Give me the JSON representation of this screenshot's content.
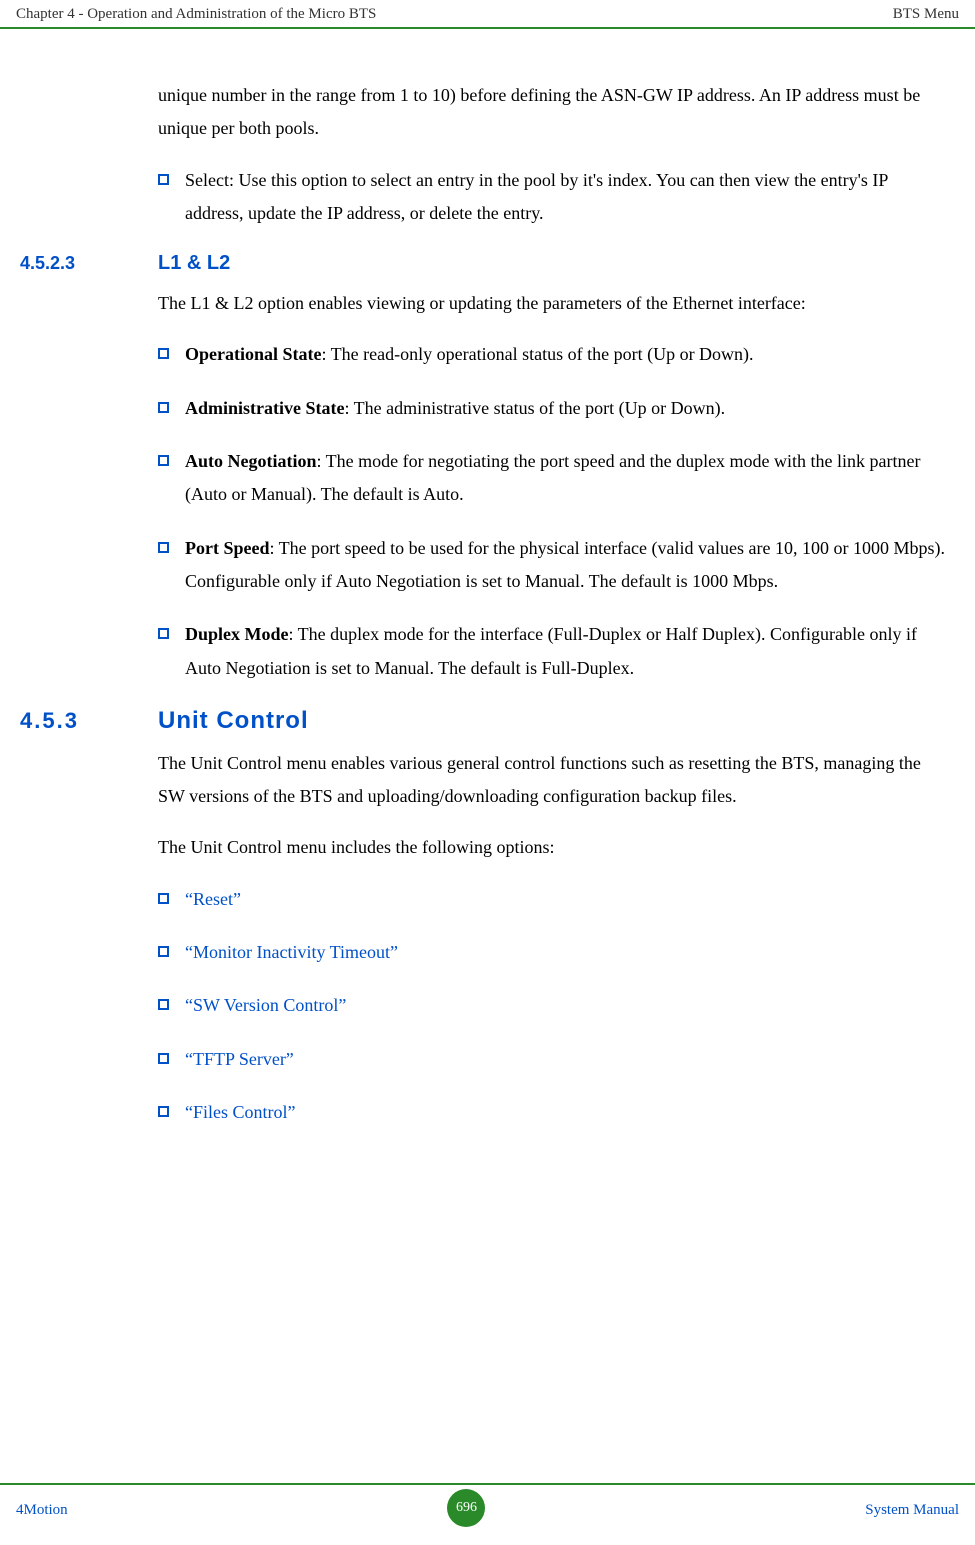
{
  "header": {
    "left": "Chapter 4 - Operation and Administration of the Micro BTS",
    "right": "BTS Menu"
  },
  "intro": {
    "para1": "unique number in the range from 1 to 10) before defining the ASN-GW IP address. An IP address must be unique per both pools.",
    "select_item": "Select: Use this option to select an entry in the pool by it's index. You can then view the entry's IP address, update the IP address, or delete the entry."
  },
  "section_4523": {
    "num": "4.5.2.3",
    "title": "L1 & L2",
    "para": "The L1 & L2 option enables viewing or updating the parameters of the Ethernet interface:",
    "items": [
      {
        "bold": "Operational State",
        "rest": ": The read-only operational status of the port (Up or Down)."
      },
      {
        "bold": "Administrative State",
        "rest": ": The administrative status of the port (Up or Down)."
      },
      {
        "bold": "Auto Negotiation",
        "rest": ": The mode for negotiating the port speed and the duplex mode with the link partner (Auto or Manual). The default is Auto."
      },
      {
        "bold": "Port Speed",
        "rest": ": The port speed to be used for the physical interface (valid values are 10, 100 or 1000 Mbps). Configurable only if Auto Negotiation is set to Manual. The default is 1000 Mbps."
      },
      {
        "bold": "Duplex Mode",
        "rest": ": The duplex mode for the interface (Full-Duplex or Half Duplex). Configurable only if Auto Negotiation is set to Manual. The default is Full-Duplex."
      }
    ]
  },
  "section_453": {
    "num": "4.5.3",
    "title": "Unit Control",
    "para1": "The Unit Control menu enables various general control functions such as resetting the BTS, managing the SW versions of the BTS and uploading/downloading configuration backup files.",
    "para2": "The Unit Control menu includes the following options:",
    "links": [
      "“Reset”",
      "“Monitor Inactivity Timeout”",
      "“SW Version Control”",
      "“TFTP Server”",
      "“Files Control”"
    ]
  },
  "footer": {
    "left": "4Motion",
    "page": "696",
    "right": "System Manual"
  }
}
